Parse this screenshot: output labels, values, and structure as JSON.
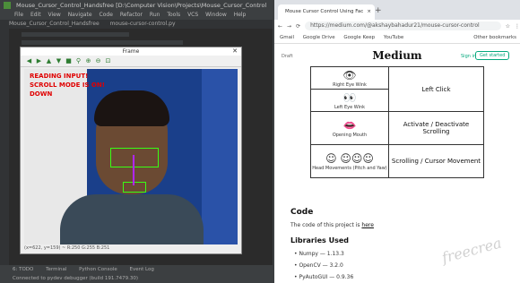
{
  "ide": {
    "title": "Mouse_Cursor_Control_Handsfree [D:\\Computer Vision\\Projects\\Mouse_Cursor_Control",
    "menu": [
      "File",
      "Edit",
      "View",
      "Navigate",
      "Code",
      "Refactor",
      "Run",
      "Tools",
      "VCS",
      "Window",
      "Help"
    ],
    "tabs": [
      "Mouse_Cursor_Control_Handsfree",
      "mouse-cursor-control.py"
    ],
    "status_row1": [
      "6: TODO",
      "Terminal",
      "Python Console",
      "Event Log"
    ],
    "status_row2": "Connected to pydev debugger (build 191.7479.30)"
  },
  "frame": {
    "title": "Frame",
    "close": "✕",
    "toolbar_icons": [
      "arrow-left-icon",
      "arrow-right-icon",
      "arrow-up-icon",
      "arrow-down-icon",
      "save-icon",
      "zoom-icon",
      "zoom-in-icon",
      "zoom-out-icon",
      "fit-icon"
    ],
    "overlay": [
      "READING INPUT!",
      "SCROLL MODE IS ON!",
      "DOWN"
    ],
    "status": "(x=622, y=159) ~ R:250 G:255 B:251"
  },
  "browser": {
    "tab_title": "Mouse Cursor Control Using Fac",
    "tab_close": "×",
    "new_tab": "+",
    "url": "https://medium.com/@akshaybahadur21/mouse-cursor-control",
    "bookmarks": [
      "Gmail",
      "Google Drive",
      "Google Keep",
      "YouTube"
    ],
    "extra_bookmark": "Other bookmarks",
    "medium": {
      "logo": "Medium",
      "left_link": "Draft",
      "signin": "Sign in",
      "get_started": "Get started"
    },
    "gestures": [
      {
        "caption": "Right Eye Wink",
        "glyph": "👁",
        "action": ""
      },
      {
        "caption": "Left Eye Wink",
        "glyph": "👀",
        "action": "Left Click"
      },
      {
        "caption": "Opening Mouth",
        "glyph": "👄",
        "action": "Activate / Deactivate Scrolling"
      },
      {
        "caption": "Head Movements (Pitch and Yaw)",
        "glyph": "☺ ☺☺☺",
        "action": "Scrolling / Cursor Movement"
      }
    ],
    "code_heading": "Code",
    "code_text": "The code of this project is ",
    "code_link": "here",
    "libs_heading": "Libraries Used",
    "libs": [
      "Numpy — 1.13.3",
      "OpenCV — 3.2.0",
      "PyAutoGUI — 0.9.36"
    ],
    "watermark": "freecrea"
  }
}
